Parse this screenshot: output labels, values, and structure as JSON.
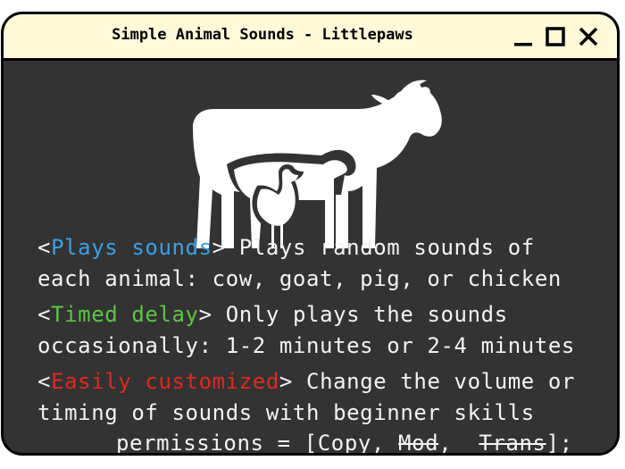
{
  "window": {
    "title": "Simple Animal Sounds - Littlepaws",
    "controls": {
      "minimize_icon": "minimize-icon",
      "maximize_icon": "maximize-icon",
      "close_icon": "close-icon"
    }
  },
  "colors": {
    "titlebar_bg": "#fef9d9",
    "content_bg": "#333333",
    "text": "#f3f3f3",
    "blue_tag": "#3aa0e8",
    "green_tag": "#5cc545",
    "red_tag": "#e0281f"
  },
  "art": {
    "icon": "cow-goat-chicken-silhouette-icon"
  },
  "features": [
    {
      "open": "<",
      "tag": "Plays sounds",
      "close": ">",
      "text_line1": " Plays random sounds of",
      "text_line2": "each animal: cow, goat, pig, or chicken"
    },
    {
      "open": "<",
      "tag": "Timed delay",
      "close": ">",
      "text_line1": " Only plays the sounds",
      "text_line2": "occasionally: 1-2 minutes or 2-4 minutes"
    },
    {
      "open": "<",
      "tag": "Easily customized",
      "close": ">",
      "text_line1": " Change the volume or",
      "text_line2": "timing of sounds with beginner skills"
    }
  ],
  "permissions": {
    "prefix": "permissions = [Copy, ",
    "mod": "Mod",
    "sep": ",  ",
    "trans": "Trans",
    "suffix": "];"
  }
}
